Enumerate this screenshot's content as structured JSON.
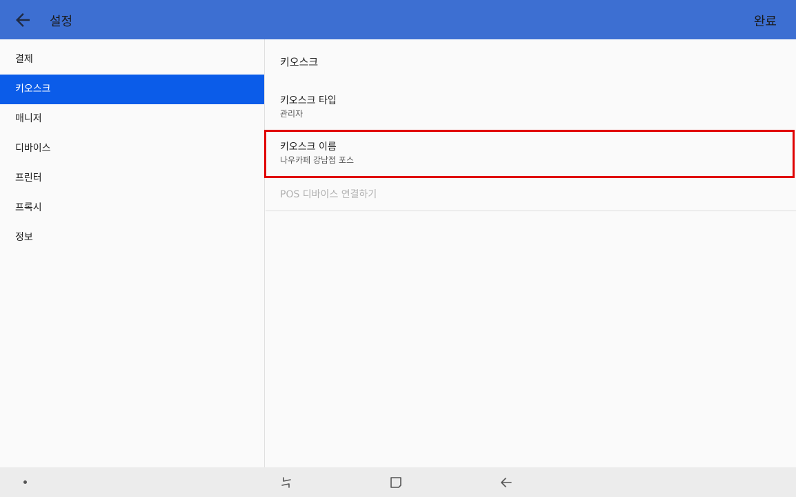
{
  "appbar": {
    "title": "설정",
    "done_label": "완료",
    "back_icon": "arrow-left-icon",
    "bg_color": "#3d6fd2"
  },
  "sidebar": {
    "items": [
      {
        "label": "결제",
        "active": false
      },
      {
        "label": "키오스크",
        "active": true
      },
      {
        "label": "매니저",
        "active": false
      },
      {
        "label": "디바이스",
        "active": false
      },
      {
        "label": "프린터",
        "active": false
      },
      {
        "label": "프록시",
        "active": false
      },
      {
        "label": "정보",
        "active": false
      }
    ],
    "active_color": "#0b5ce9"
  },
  "content": {
    "section_title": "키오스크",
    "kiosk_type": {
      "title": "키오스크 타입",
      "summary": "관리자"
    },
    "kiosk_name": {
      "title": "키오스크 이름",
      "summary": "나우카페 강남점 포스"
    },
    "pos_connect": {
      "title": "POS 디바이스 연결하기",
      "enabled": false
    },
    "highlight_color": "#e00000"
  },
  "navbar": {
    "icons": [
      "dot-icon",
      "recent-apps-icon",
      "home-icon",
      "back-icon"
    ]
  }
}
